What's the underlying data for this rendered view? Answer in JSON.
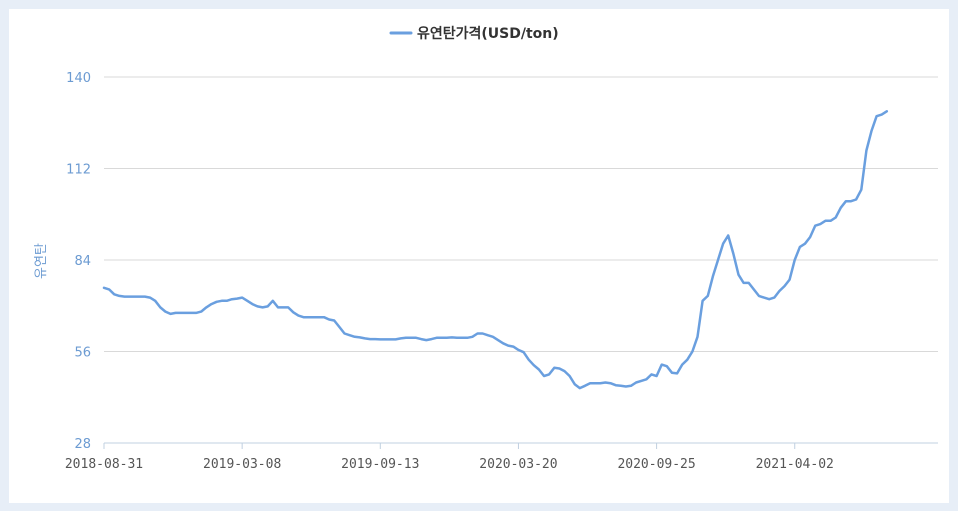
{
  "chart_data": {
    "type": "line",
    "title": "",
    "xlabel": "",
    "ylabel": "유연탄",
    "ylim": [
      28,
      140
    ],
    "yticks": [
      28,
      56,
      84,
      112,
      140
    ],
    "grid": true,
    "legend_position": "top-center",
    "x_tick_labels": [
      "2018-08-31",
      "2019-03-08",
      "2019-09-13",
      "2020-03-20",
      "2020-09-25",
      "2021-04-02"
    ],
    "x_start": "2018-08-31",
    "x_end": "2021-10-15",
    "colors": {
      "series": "#6a9fdf",
      "grid": "#d9d9d9",
      "axis": "#c0d0e0",
      "tick_y": "#6c9bd2"
    },
    "series": [
      {
        "name": "유연탄가격(USD/ton)",
        "points": [
          [
            "2018-08-31",
            75.5
          ],
          [
            "2018-09-07",
            75
          ],
          [
            "2018-09-14",
            73.5
          ],
          [
            "2018-09-21",
            73
          ],
          [
            "2018-09-28",
            72.8
          ],
          [
            "2018-10-05",
            72.8
          ],
          [
            "2018-10-12",
            72.8
          ],
          [
            "2018-10-19",
            72.8
          ],
          [
            "2018-10-26",
            72.8
          ],
          [
            "2018-11-02",
            72.5
          ],
          [
            "2018-11-09",
            71.5
          ],
          [
            "2018-11-16",
            69.5
          ],
          [
            "2018-11-23",
            68.2
          ],
          [
            "2018-11-30",
            67.5
          ],
          [
            "2018-12-07",
            67.8
          ],
          [
            "2018-12-14",
            67.8
          ],
          [
            "2018-12-21",
            67.8
          ],
          [
            "2018-12-28",
            67.8
          ],
          [
            "2019-01-04",
            67.8
          ],
          [
            "2019-01-11",
            68.2
          ],
          [
            "2019-01-18",
            69.5
          ],
          [
            "2019-01-25",
            70.5
          ],
          [
            "2019-02-01",
            71.2
          ],
          [
            "2019-02-08",
            71.5
          ],
          [
            "2019-02-15",
            71.5
          ],
          [
            "2019-02-22",
            72
          ],
          [
            "2019-03-01",
            72.2
          ],
          [
            "2019-03-08",
            72.5
          ],
          [
            "2019-03-15",
            71.5
          ],
          [
            "2019-03-22",
            70.5
          ],
          [
            "2019-03-29",
            69.8
          ],
          [
            "2019-04-05",
            69.5
          ],
          [
            "2019-04-12",
            69.8
          ],
          [
            "2019-04-19",
            71.5
          ],
          [
            "2019-04-26",
            69.5
          ],
          [
            "2019-05-03",
            69.5
          ],
          [
            "2019-05-10",
            69.5
          ],
          [
            "2019-05-17",
            68
          ],
          [
            "2019-05-24",
            67
          ],
          [
            "2019-05-31",
            66.5
          ],
          [
            "2019-06-07",
            66.5
          ],
          [
            "2019-06-14",
            66.5
          ],
          [
            "2019-06-21",
            66.5
          ],
          [
            "2019-06-28",
            66.5
          ],
          [
            "2019-07-05",
            65.8
          ],
          [
            "2019-07-12",
            65.5
          ],
          [
            "2019-07-19",
            63.5
          ],
          [
            "2019-07-26",
            61.5
          ],
          [
            "2019-08-02",
            61
          ],
          [
            "2019-08-09",
            60.5
          ],
          [
            "2019-08-16",
            60.3
          ],
          [
            "2019-08-23",
            60
          ],
          [
            "2019-08-30",
            59.8
          ],
          [
            "2019-09-06",
            59.8
          ],
          [
            "2019-09-13",
            59.7
          ],
          [
            "2019-09-20",
            59.7
          ],
          [
            "2019-09-27",
            59.7
          ],
          [
            "2019-10-04",
            59.7
          ],
          [
            "2019-10-11",
            60
          ],
          [
            "2019-10-18",
            60.2
          ],
          [
            "2019-10-25",
            60.2
          ],
          [
            "2019-11-01",
            60.2
          ],
          [
            "2019-11-08",
            59.8
          ],
          [
            "2019-11-15",
            59.5
          ],
          [
            "2019-11-22",
            59.8
          ],
          [
            "2019-11-29",
            60.2
          ],
          [
            "2019-12-06",
            60.2
          ],
          [
            "2019-12-13",
            60.2
          ],
          [
            "2019-12-20",
            60.3
          ],
          [
            "2019-12-27",
            60.2
          ],
          [
            "2020-01-03",
            60.2
          ],
          [
            "2020-01-10",
            60.2
          ],
          [
            "2020-01-17",
            60.5
          ],
          [
            "2020-01-24",
            61.5
          ],
          [
            "2020-01-31",
            61.5
          ],
          [
            "2020-02-07",
            61
          ],
          [
            "2020-02-14",
            60.5
          ],
          [
            "2020-02-21",
            59.5
          ],
          [
            "2020-02-28",
            58.5
          ],
          [
            "2020-03-06",
            57.8
          ],
          [
            "2020-03-13",
            57.5
          ],
          [
            "2020-03-20",
            56.5
          ],
          [
            "2020-03-27",
            55.8
          ],
          [
            "2020-04-03",
            53.5
          ],
          [
            "2020-04-10",
            51.8
          ],
          [
            "2020-04-17",
            50.5
          ],
          [
            "2020-04-24",
            48.5
          ],
          [
            "2020-05-01",
            49
          ],
          [
            "2020-05-08",
            51
          ],
          [
            "2020-05-15",
            50.8
          ],
          [
            "2020-05-22",
            50
          ],
          [
            "2020-05-29",
            48.5
          ],
          [
            "2020-06-05",
            46
          ],
          [
            "2020-06-12",
            44.8
          ],
          [
            "2020-06-19",
            45.5
          ],
          [
            "2020-06-26",
            46.3
          ],
          [
            "2020-07-03",
            46.3
          ],
          [
            "2020-07-10",
            46.3
          ],
          [
            "2020-07-17",
            46.5
          ],
          [
            "2020-07-24",
            46.3
          ],
          [
            "2020-07-31",
            45.7
          ],
          [
            "2020-08-07",
            45.5
          ],
          [
            "2020-08-14",
            45.3
          ],
          [
            "2020-08-21",
            45.5
          ],
          [
            "2020-08-28",
            46.5
          ],
          [
            "2020-09-04",
            47
          ],
          [
            "2020-09-11",
            47.5
          ],
          [
            "2020-09-18",
            49
          ],
          [
            "2020-09-25",
            48.5
          ],
          [
            "2020-10-02",
            52
          ],
          [
            "2020-10-09",
            51.5
          ],
          [
            "2020-10-16",
            49.5
          ],
          [
            "2020-10-23",
            49.3
          ],
          [
            "2020-10-30",
            52
          ],
          [
            "2020-11-06",
            53.5
          ],
          [
            "2020-11-13",
            56
          ],
          [
            "2020-11-20",
            60.5
          ],
          [
            "2020-11-27",
            71.5
          ],
          [
            "2020-12-04",
            73
          ],
          [
            "2020-12-11",
            79
          ],
          [
            "2020-12-18",
            84
          ],
          [
            "2020-12-25",
            89
          ],
          [
            "2021-01-01",
            91.5
          ],
          [
            "2021-01-08",
            86
          ],
          [
            "2021-01-15",
            79.5
          ],
          [
            "2021-01-22",
            77
          ],
          [
            "2021-01-29",
            77
          ],
          [
            "2021-02-05",
            75
          ],
          [
            "2021-02-12",
            73
          ],
          [
            "2021-02-19",
            72.5
          ],
          [
            "2021-02-26",
            72
          ],
          [
            "2021-03-05",
            72.5
          ],
          [
            "2021-03-12",
            74.5
          ],
          [
            "2021-03-19",
            76
          ],
          [
            "2021-03-26",
            78
          ],
          [
            "2021-04-02",
            84
          ],
          [
            "2021-04-09",
            88
          ],
          [
            "2021-04-16",
            89
          ],
          [
            "2021-04-23",
            91
          ],
          [
            "2021-04-30",
            94.5
          ],
          [
            "2021-05-07",
            95
          ],
          [
            "2021-05-14",
            96
          ],
          [
            "2021-05-21",
            96
          ],
          [
            "2021-05-28",
            97
          ],
          [
            "2021-06-04",
            100
          ],
          [
            "2021-06-11",
            102
          ],
          [
            "2021-06-18",
            102
          ],
          [
            "2021-06-25",
            102.5
          ],
          [
            "2021-07-02",
            105.5
          ],
          [
            "2021-07-09",
            117.5
          ],
          [
            "2021-07-16",
            123.5
          ],
          [
            "2021-07-23",
            128
          ],
          [
            "2021-07-30",
            128.5
          ],
          [
            "2021-08-06",
            129.5
          ]
        ]
      }
    ]
  }
}
